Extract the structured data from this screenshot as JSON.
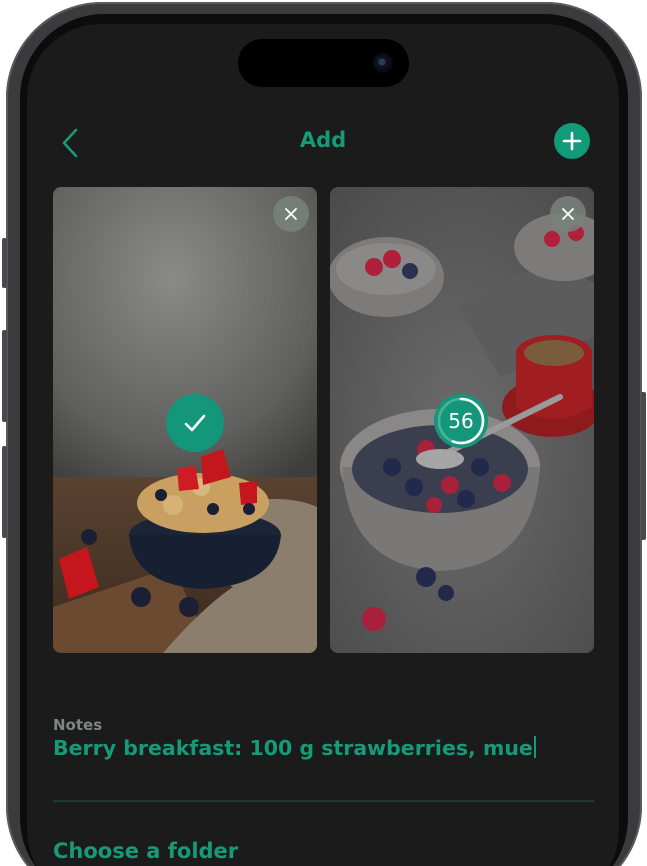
{
  "header": {
    "title": "Add",
    "back_icon": "chevron-left-icon",
    "add_icon": "plus-icon"
  },
  "photos": [
    {
      "description": "cereal bowl with strawberries",
      "status": "selected",
      "status_icon": "checkmark-icon",
      "remove_icon": "close-icon"
    },
    {
      "description": "yogurt bowl with berries and coffee",
      "status": "uploading",
      "progress": 56,
      "progress_label": "56",
      "remove_icon": "close-icon"
    }
  ],
  "notes": {
    "label": "Notes",
    "value": "Berry breakfast: 100 g strawberries, mue"
  },
  "folder": {
    "label": "Choose a folder"
  },
  "colors": {
    "accent": "#169a78",
    "background": "#1b1b1c",
    "muted": "#7d8684"
  }
}
